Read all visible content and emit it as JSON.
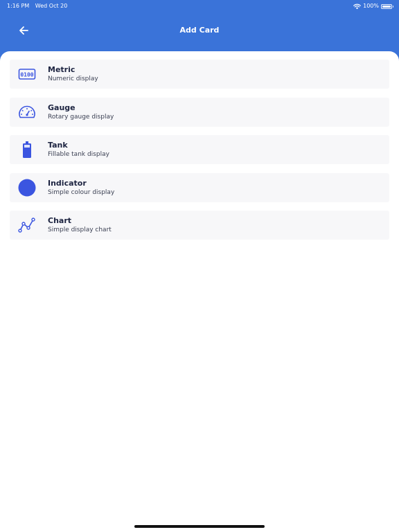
{
  "status_bar": {
    "time": "1:16 PM",
    "date": "Wed Oct 20",
    "battery": "100%"
  },
  "header": {
    "title": "Add Card"
  },
  "colors": {
    "header_background": "#3a73d9",
    "icon_accent": "#3b55e0",
    "card_background": "#f7f7f9"
  },
  "cards": [
    {
      "title": "Metric",
      "subtitle": "Numeric display",
      "icon": "metric-icon"
    },
    {
      "title": "Gauge",
      "subtitle": "Rotary gauge display",
      "icon": "gauge-icon"
    },
    {
      "title": "Tank",
      "subtitle": "Fillable tank display",
      "icon": "tank-icon"
    },
    {
      "title": "Indicator",
      "subtitle": "Simple colour display",
      "icon": "indicator-icon"
    },
    {
      "title": "Chart",
      "subtitle": "Simple display chart",
      "icon": "chart-icon"
    }
  ]
}
